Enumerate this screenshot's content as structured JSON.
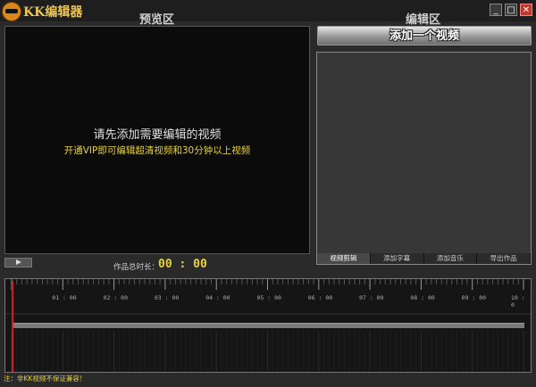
{
  "window": {
    "title": "KK编辑器",
    "controls": {
      "minimize": "_",
      "maximize": "□",
      "close": "✕"
    }
  },
  "preview": {
    "label": "预览区",
    "message": "请先添加需要编辑的视频",
    "vip_tip": "开通VIP即可编辑超清视频和30分钟以上视频",
    "duration_label": "作品总时长：",
    "duration_value": "00 : 00"
  },
  "edit": {
    "label": "编辑区",
    "add_video_button": "添加一个视频",
    "tabs": [
      {
        "label": "视频剪辑",
        "active": true
      },
      {
        "label": "添加字幕",
        "active": false
      },
      {
        "label": "添加音乐",
        "active": false
      },
      {
        "label": "导出作品",
        "active": false
      }
    ]
  },
  "timeline": {
    "marks": [
      "01 : 00",
      "02 : 00",
      "03 : 00",
      "04 : 00",
      "05 : 00",
      "06 : 00",
      "07 : 00",
      "08 : 00",
      "09 : 00",
      "10 : 0"
    ]
  },
  "footer": {
    "note": "注：非KK视频不保证兼容！"
  },
  "colors": {
    "accent_yellow": "#e8d23a",
    "playhead": "#d41a1a",
    "close_button": "#c0392b"
  }
}
